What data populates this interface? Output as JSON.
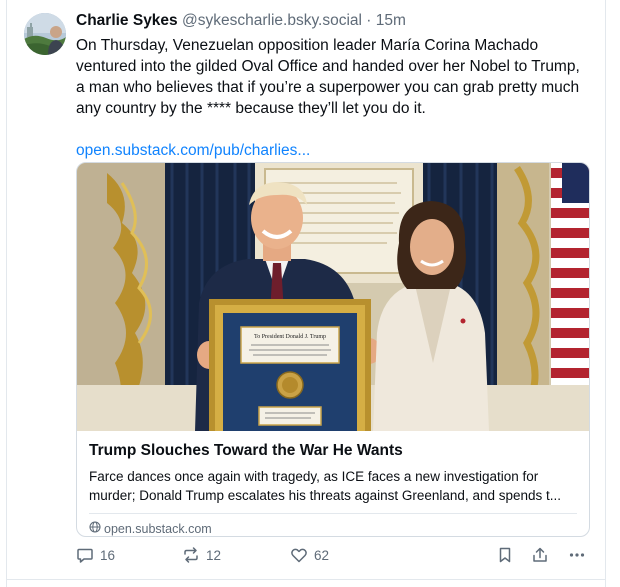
{
  "post": {
    "author_name": "Charlie Sykes",
    "handle": "@sykescharlie.bsky.social",
    "separator": "·",
    "time": "15m",
    "text": "On Thursday, Venezuelan opposition leader María Corina Machado ventured into the gilded Oval Office and handed over her Nobel to Trump, a man who believes that if you’re a superpower you can grab pretty much any country by the **** because they’ll let you do it.",
    "link": "open.substack.com/pub/charlies..."
  },
  "card": {
    "title": "Trump Slouches Toward the War He Wants",
    "description": "Farce dances once again with tragedy, as ICE faces a new investigation for murder; Donald Trump escalates his threats against Greenland, and spends t...",
    "domain": "open.substack.com",
    "frame_heading": "To President Donald J. Trump"
  },
  "actions": {
    "replies": "16",
    "reposts": "12",
    "likes": "62"
  },
  "icons": [
    "reply-icon",
    "repost-icon",
    "like-icon",
    "bookmark-icon",
    "share-icon",
    "more-icon",
    "globe-icon"
  ],
  "colors": {
    "link": "#1083fe",
    "muted": "#5f6b78",
    "border": "#d4dbe2"
  }
}
